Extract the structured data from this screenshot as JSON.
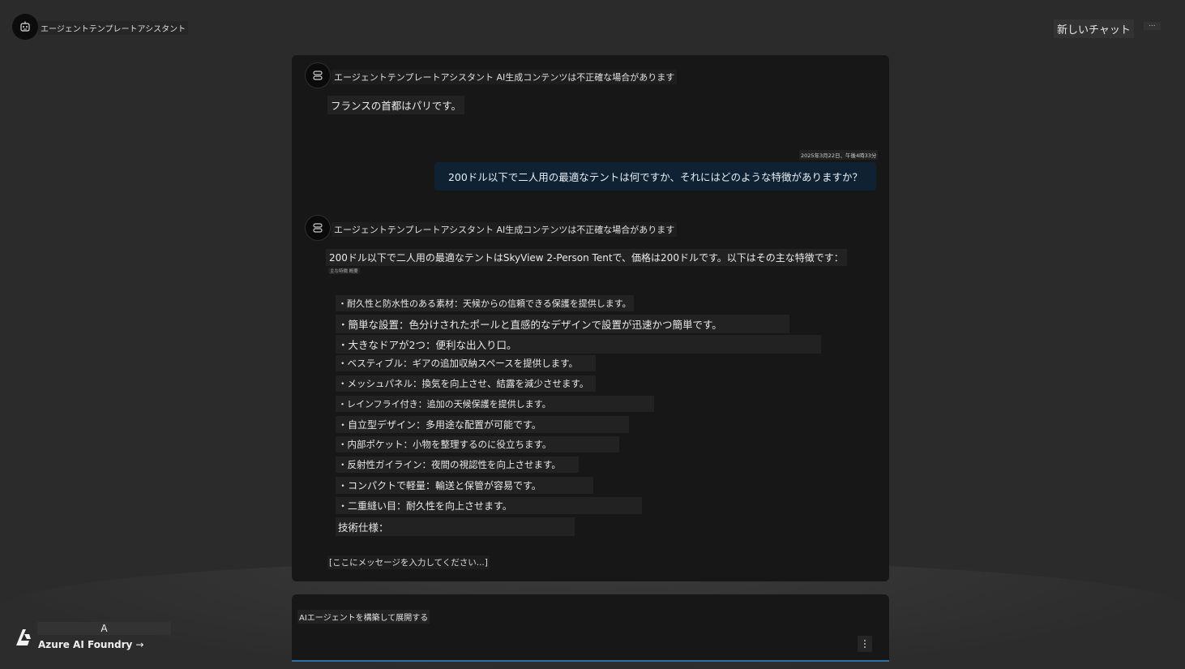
{
  "header": {
    "app_title": "エージェントテンプレートアシスタント",
    "new_chat_label": "新しいチャット",
    "more_label": "..."
  },
  "chat": {
    "messages": [
      {
        "role": "assistant",
        "header": "エージェントテンプレートアシスタント AI生成コンテンツは不正確な場合があります",
        "text": "フランスの首都はパリです。"
      },
      {
        "role": "user",
        "timestamp": "2025年3月22日、午後4時33分",
        "text": "200ドル以下で二人用の最適なテントは何ですか、それにはどのような特徴がありますか？"
      },
      {
        "role": "assistant",
        "header": "エージェントテンプレートアシスタント AI生成コンテンツは不正確な場合があります",
        "intro": "200ドル以下で二人用の最適なテントはSkyView 2-Person Tentで、価格は200ドルです。以下はその主な特徴です：",
        "subline": "主な特徴 概要",
        "features": [
          "・耐久性と防水性のある素材：天候からの信頼できる保護を提供します。",
          "・簡単な設置：色分けされたポールと直感的なデザインで設置が迅速かつ簡単です。",
          "・大きなドアが2つ：便利な出入り口。",
          "・ベスティブル：ギアの追加収納スペースを提供します。",
          "・メッシュパネル：換気を向上させ、結露を減少させます。",
          "・レインフライ付き：追加の天候保護を提供します。",
          "・自立型デザイン：多用途な配置が可能です。",
          "・内部ポケット：小物を整理するのに役立ちます。",
          "・反射性ガイライン：夜間の視認性を向上させます。",
          "・コンパクトで軽量：輸送と保管が容易です。",
          "・二重縫い目：耐久性を向上させます。",
          "技術仕様："
        ]
      }
    ],
    "input_placeholder": "[ここにメッセージを入力してください...]"
  },
  "composer": {
    "text": "AIエージェントを構築して展開する"
  },
  "footer": {
    "initial": "A",
    "brand_label": "Azure AI Foundry",
    "arrow": "→"
  },
  "colors": {
    "background": "#2b2b2b",
    "panel": "#171717",
    "user_bubble": "#0f2233",
    "accent": "#2f6fa0"
  }
}
